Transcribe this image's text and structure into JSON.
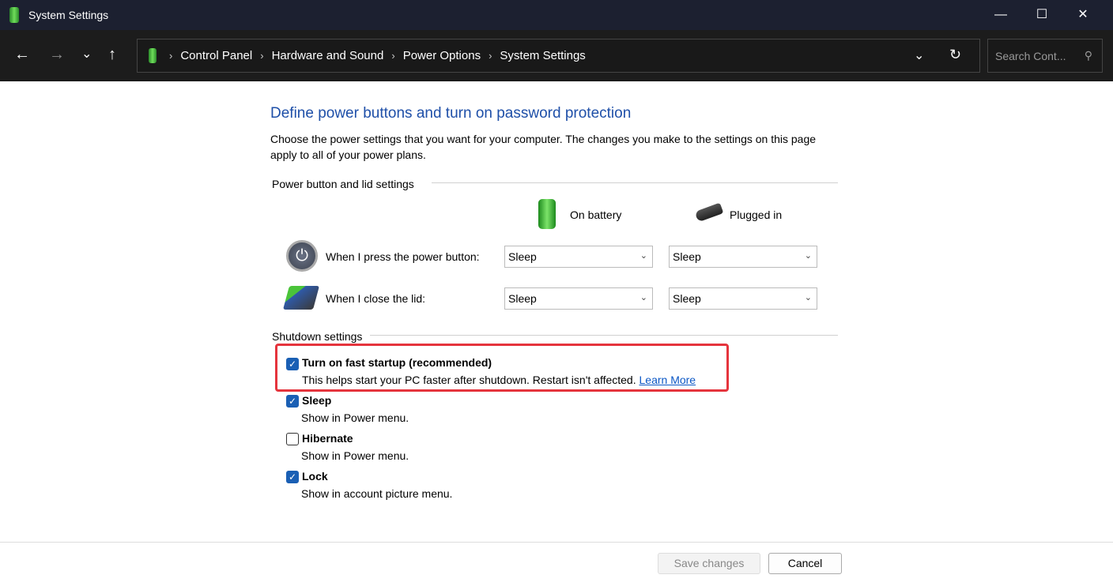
{
  "window": {
    "title": "System Settings"
  },
  "nav": {
    "back": "←",
    "forward": "→",
    "recent": "⌄",
    "up": "↑"
  },
  "breadcrumb": [
    "Control Panel",
    "Hardware and Sound",
    "Power Options",
    "System Settings"
  ],
  "search": {
    "placeholder": "Search Cont..."
  },
  "page": {
    "title": "Define power buttons and turn on password protection",
    "description": "Choose the power settings that you want for your computer. The changes you make to the settings on this page apply to all of your power plans.",
    "power_group": "Power button and lid settings",
    "col_battery": "On battery",
    "col_plugged": "Plugged in",
    "rows": [
      {
        "label": "When I press the power button:",
        "battery": "Sleep",
        "plugged": "Sleep"
      },
      {
        "label": "When I close the lid:",
        "battery": "Sleep",
        "plugged": "Sleep"
      }
    ],
    "shutdown_group": "Shutdown settings",
    "options": [
      {
        "label": "Turn on fast startup (recommended)",
        "desc": "This helps start your PC faster after shutdown. Restart isn't affected.",
        "checked": true,
        "link": "Learn More"
      },
      {
        "label": "Sleep",
        "desc": "Show in Power menu.",
        "checked": true
      },
      {
        "label": "Hibernate",
        "desc": "Show in Power menu.",
        "checked": false
      },
      {
        "label": "Lock",
        "desc": "Show in account picture menu.",
        "checked": true
      }
    ]
  },
  "footer": {
    "save": "Save changes",
    "cancel": "Cancel"
  },
  "colors": {
    "accent": "#1a5fb4",
    "title": "#1e4fa8",
    "highlight": "#e5343d"
  }
}
